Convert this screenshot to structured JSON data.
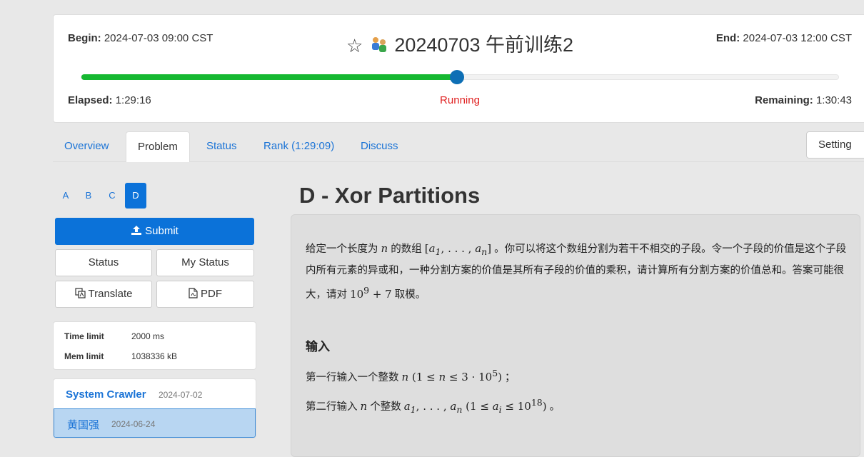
{
  "contest": {
    "begin_label": "Begin:",
    "begin_value": "2024-07-03 09:00 CST",
    "end_label": "End:",
    "end_value": "2024-07-03 12:00 CST",
    "title": "20240703 午前训练2",
    "elapsed_label": "Elapsed:",
    "elapsed_value": "1:29:16",
    "remaining_label": "Remaining:",
    "remaining_value": "1:30:43",
    "status": "Running",
    "progress": 0.496,
    "progress_color": "#16b831",
    "status_color": "#e02323"
  },
  "tabs": [
    {
      "label": "Overview"
    },
    {
      "label": "Problem",
      "active": true
    },
    {
      "label": "Status"
    },
    {
      "label": "Rank (1:29:09)"
    },
    {
      "label": "Discuss"
    }
  ],
  "setting_label": "Setting",
  "problem_letters": [
    "A",
    "B",
    "C",
    "D"
  ],
  "active_letter": "D",
  "buttons": {
    "submit": "Submit",
    "status": "Status",
    "my_status": "My Status",
    "translate": "Translate",
    "pdf": "PDF"
  },
  "limits": {
    "time_label": "Time limit",
    "time_value": "2000 ms",
    "mem_label": "Mem limit",
    "mem_value": "1038336 kB"
  },
  "authors": [
    {
      "name": "System Crawler",
      "date": "2024-07-02"
    },
    {
      "name": "黄国强",
      "date": "2024-06-24",
      "selected": true
    }
  ],
  "problem": {
    "title": "D - Xor Partitions",
    "desc_1": "给定一个长度为",
    "desc_2": "的数组",
    "desc_3": "。你可以将这个数组分割为若干不相交的子段。令一个子段的价值是这个子段内所有元素的异或和，一种分割方案的价值是其所有子段的价值的乘积，请计算所有分割方案的价值总和。答案可能很大，请对",
    "desc_4": "取模。",
    "input_title": "输入",
    "input_1a": "第一行输入一个整数",
    "input_1b": "；",
    "input_2a": "第二行输入",
    "input_2b": "个整数",
    "input_2c": "。"
  },
  "colors": {
    "accent": "#0b72d9",
    "link": "#1a73d6",
    "background": "#e8e8e8"
  },
  "icons": [
    "star-icon",
    "team-icon",
    "upload-icon",
    "translate-icon",
    "pdf-icon"
  ]
}
